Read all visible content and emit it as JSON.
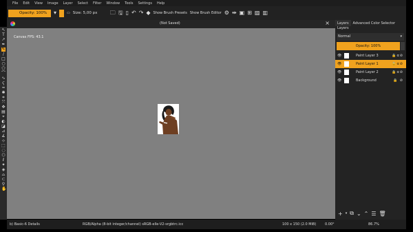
{
  "menu": [
    "File",
    "Edit",
    "View",
    "Image",
    "Layer",
    "Select",
    "Filter",
    "Window",
    "Tools",
    "Settings",
    "Help"
  ],
  "toolbar": {
    "opacity": "Opacity: 100%",
    "size": "Size: 5,00 px",
    "show_brush_presets": "Show Brush Presets",
    "show_brush_editor": "Show Brush Editor"
  },
  "document": {
    "title": "(Not Saved)",
    "close": "×",
    "fps": "Canvas FPS: 43.1"
  },
  "dock": {
    "tabs": [
      "Layers",
      "Advanced Color Selector"
    ],
    "title": "Layers",
    "blending_mode": "Normal",
    "opacity": "Opacity: 100%",
    "layers": [
      {
        "name": "Paint Layer 3",
        "selected": false
      },
      {
        "name": "Paint Layer 1",
        "selected": true
      },
      {
        "name": "Paint Layer 2",
        "selected": false
      },
      {
        "name": "Background",
        "selected": false
      }
    ]
  },
  "status": {
    "brush": "b) Basic-6 Details",
    "color_space": "RGB/Alpha (8-bit integer/channel)  sRGB-elle-V2-srgbtrc.icc",
    "dimensions": "100 x 150 (2.0 MiB)",
    "rotation": "0.00°",
    "zoom": "86.7%"
  },
  "colors": {
    "accent": "#f0a21e",
    "canvas": "#808080",
    "panel": "#232323"
  }
}
